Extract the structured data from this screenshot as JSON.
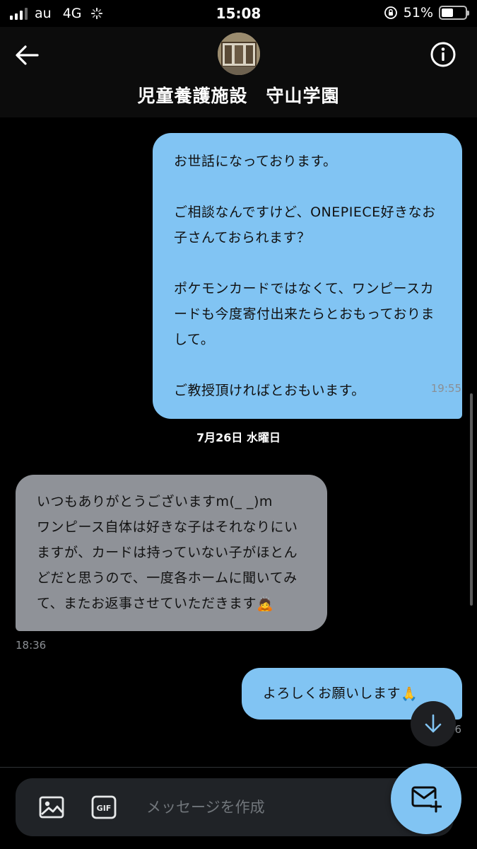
{
  "status_bar": {
    "carrier": "au",
    "network": "4G",
    "time": "15:08",
    "battery": "51%",
    "battery_level": 0.51
  },
  "header": {
    "title": "児童養護施設　守山学園",
    "back_icon": "arrow-left-icon",
    "info_icon": "info-circle-icon"
  },
  "messages": [
    {
      "direction": "outgoing",
      "text": "お世話になっております。\n\nご相談なんですけど、ONEPIECE好きなお子さんておられます？\n\nポケモンカードではなくて、ワンピースカードも今度寄付出来たらとおもっておりまして。\n\nご教授頂ければとおもいます。",
      "time": "19:55"
    },
    {
      "direction": "separator",
      "text": "7月26日 水曜日"
    },
    {
      "direction": "incoming",
      "text": "いつもありがとうございますm(_ _)m\nワンピース自体は好きな子はそれなりにいますが、カードは持っていない子がほとんどだと思うので、一度各ホームに聞いてみて、またお返事させていただきます",
      "emoji": "🙇",
      "time": "18:36"
    },
    {
      "direction": "outgoing",
      "text": "よろしくお願いします",
      "emoji": "🙏",
      "time": "6"
    }
  ],
  "composer": {
    "placeholder": "メッセージを作成",
    "gif_label": "GIF"
  },
  "colors": {
    "outgoing_bubble": "#81c4f3",
    "incoming_bubble": "#8f9298",
    "background": "#000000",
    "accent": "#81c4f3"
  }
}
